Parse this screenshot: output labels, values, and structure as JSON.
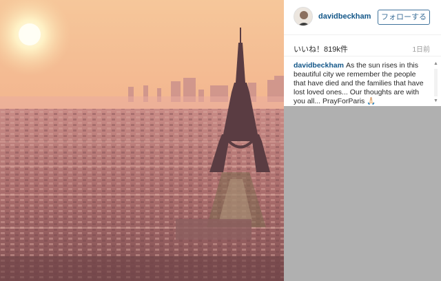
{
  "post": {
    "image_alt": "sunrise over Paris with the Eiffel Tower"
  },
  "author": {
    "username": "davidbeckham",
    "follow_label": "フォローする"
  },
  "stats": {
    "likes_text": "いいね！819k件",
    "time_ago": "1日前"
  },
  "caption": {
    "username": "davidbeckham",
    "text": "As the sun rises in this beautiful city we remember the people that have died and the families that have lost loved ones... Our thoughts are with you all... PrayForParis 🙏🏻"
  },
  "colors": {
    "username_blue": "#125688",
    "follow_blue": "#3f729b",
    "placeholder_gray": "#b0b0b0"
  }
}
